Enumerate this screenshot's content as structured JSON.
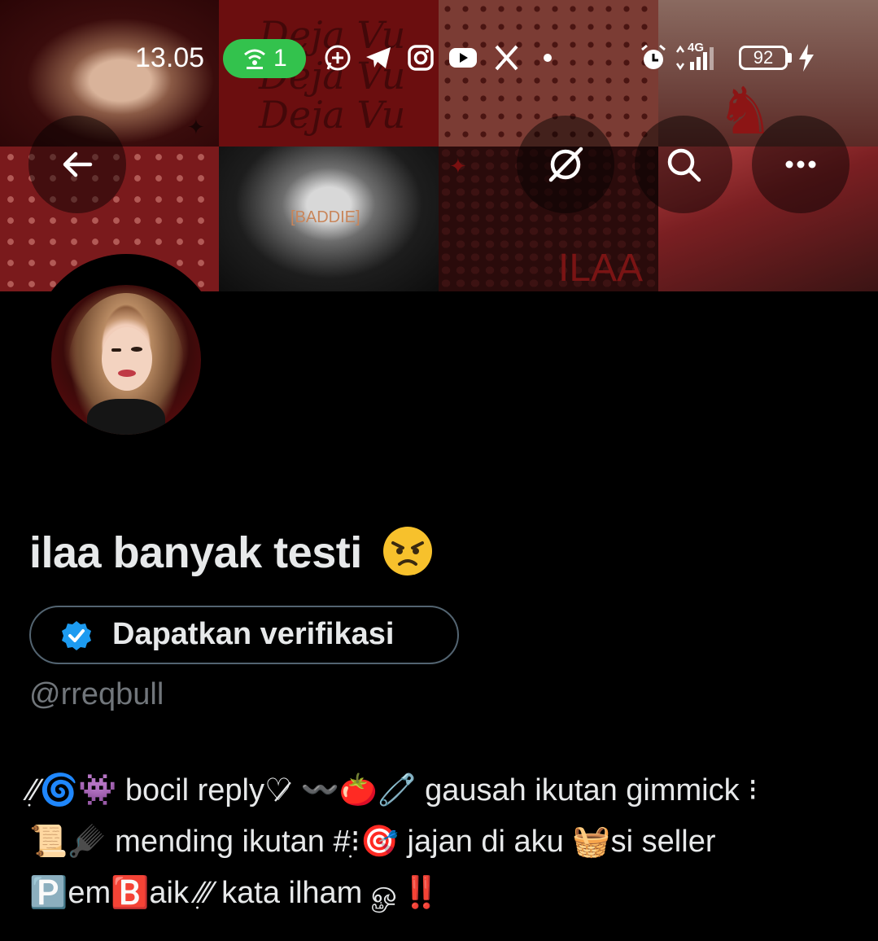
{
  "status_bar": {
    "time": "13.05",
    "hotspot_count": "1",
    "network": "4G",
    "battery": "92",
    "notification_icons": [
      "whatsapp-icon",
      "telegram-icon",
      "instagram-icon",
      "youtube-icon",
      "x-icon"
    ]
  },
  "banner": {
    "text_lines": [
      "Deja Vu",
      "Deja Vu",
      "Deja Vu"
    ],
    "baddie_text": "[BADDIE]",
    "ilaa_text": "ILAA"
  },
  "nav": {
    "back": "back-arrow-icon",
    "grok": "grok-icon",
    "search": "search-icon",
    "more": "more-icon"
  },
  "profile": {
    "display_name": "ilaa banyak testi",
    "name_emoji": "😠",
    "verify_label": "Dapatkan verifikasi",
    "handle": "@rreqbull",
    "bio": "ׅ⁄⁄🌀👾 bocil reply♡̷ 〰️🍅🧷 gausah ikutan gimmick ⁝\n📜🪮 mending ikutan #ׅ⁝🎯 jajan di aku 🧺si seller\n🅿️em🅱️aik ׅ⁄⁄⁄ kata ilham ௐ‼️"
  },
  "colors": {
    "background": "#000000",
    "text_primary": "#e7e9ea",
    "text_secondary": "#71767b",
    "border": "#536471",
    "verified_blue": "#1d9bf0",
    "hotspot_green": "#33c24d"
  }
}
